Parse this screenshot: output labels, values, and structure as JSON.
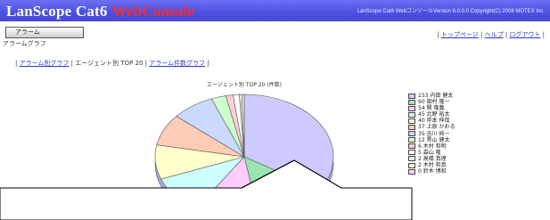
{
  "header": {
    "brand": "LanScope Cat6",
    "brand_web": "WebConsole",
    "copyright": "LanScope Cat6 WebコンソールVersion 6.0.0.0 Copyright(C) 2008 MOTEX Inc."
  },
  "nav": {
    "alarm_button": "アラーム",
    "breadcrumb": "アラームグラフ",
    "links": [
      "トップページ",
      "ヘルプ",
      "ログアウト"
    ]
  },
  "tabs": {
    "items": [
      "アラーム別グラフ",
      "エージェント別 TOP 20",
      "アラーム件数グラフ"
    ],
    "active": 1
  },
  "chart_data": {
    "type": "pie",
    "title": "エージェント別 TOP 20 (件数)",
    "labels": [
      "153 内田 健太",
      "60 田村 隆一",
      "54 関 隆義",
      "45 北野 裕太",
      "40 岸本 伸哉",
      "37 上原 かおる",
      "35 吉川 純一",
      "12 黒山 健太",
      "6 木村 和明",
      "5 森山 隆",
      "2 高橋 真理",
      "2 木村 和真",
      "0 鈴木 博和"
    ],
    "values": [
      153,
      60,
      54,
      45,
      40,
      37,
      35,
      12,
      6,
      5,
      2,
      2,
      0
    ],
    "colors": [
      "#cccaff",
      "#99e6b3",
      "#ffccff",
      "#ccffff",
      "#ffffcc",
      "#ffccb8",
      "#ccd9ff",
      "#ccffcc",
      "#ffccd9",
      "#ffffff",
      "#e6e6e6",
      "#f0f0d0",
      "#ffd0ff"
    ]
  }
}
